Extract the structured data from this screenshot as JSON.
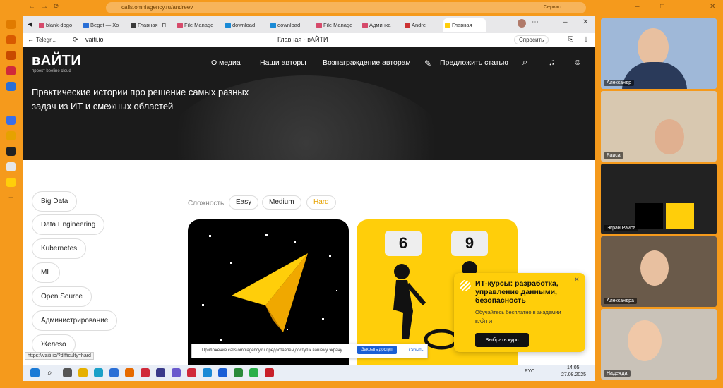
{
  "outer_browser": {
    "url": "calls.omniagency.ru/andreev",
    "right_label": "Сервис"
  },
  "tabs": [
    {
      "label": "blank-dogo",
      "color": "#d64a6b"
    },
    {
      "label": "Beget — Хо",
      "color": "#2a6fd6"
    },
    {
      "label": "Главная | П",
      "color": "#3a3a3a"
    },
    {
      "label": "File Manage",
      "color": "#d64a6b"
    },
    {
      "label": "download",
      "color": "#1a8ad6"
    },
    {
      "label": "download",
      "color": "#1a8ad6"
    },
    {
      "label": "File Manage",
      "color": "#d64a6b"
    },
    {
      "label": "Админка",
      "color": "#d64a6b"
    },
    {
      "label": "Andre",
      "color": "#c33"
    },
    {
      "label": "Главная",
      "color": "#ffce0a"
    }
  ],
  "address_bar": {
    "back_label": "Telegr...",
    "url": "vaiti.io",
    "page_title": "Главная - вАЙТИ",
    "ask_label": "Спросить"
  },
  "site": {
    "logo": "вАЙТИ",
    "logo_sub": "проект beeline cloud",
    "nav": [
      "О медиа",
      "Наши авторы",
      "Вознаграждение авторам"
    ],
    "suggest_label": "Предложить статью",
    "tagline": "Практические истории про решение самых разных задач из ИТ и смежных областей",
    "categories": [
      "Big Data",
      "Data Engineering",
      "Kubernetes",
      "ML",
      "Open Source",
      "Администрирование",
      "Железо"
    ],
    "difficulty_label": "Сложность",
    "difficulty": [
      "Easy",
      "Medium",
      "Hard"
    ],
    "card2_numbers": [
      "6",
      "9"
    ],
    "promo": {
      "title": "ИТ-курсы: разработка, управление данными, безопасность",
      "text": "Обучайтесь бесплатно в академии вАЙТИ",
      "button": "Выбрать курс"
    }
  },
  "notice": {
    "text": "Приложение calls.omniagency.ru предоставлен доступ к вашему экрану.",
    "primary": "Закрыть доступ",
    "secondary": "Скрыть"
  },
  "link_tip": "https://vaiti.io/?difficulty=hard",
  "taskbar": {
    "lang": "РУС",
    "time": "14:05",
    "date": "27.08.2025"
  },
  "participants": [
    {
      "name": "Александр",
      "bg": "#9fb8d8"
    },
    {
      "name": "Раиса",
      "bg": "#d8c8b0"
    },
    {
      "name": "Экран Раиса",
      "bg": "#222"
    },
    {
      "name": "Александра",
      "bg": "#6a5a4a"
    },
    {
      "name": "Надежда",
      "bg": "#c9c2b8"
    }
  ]
}
